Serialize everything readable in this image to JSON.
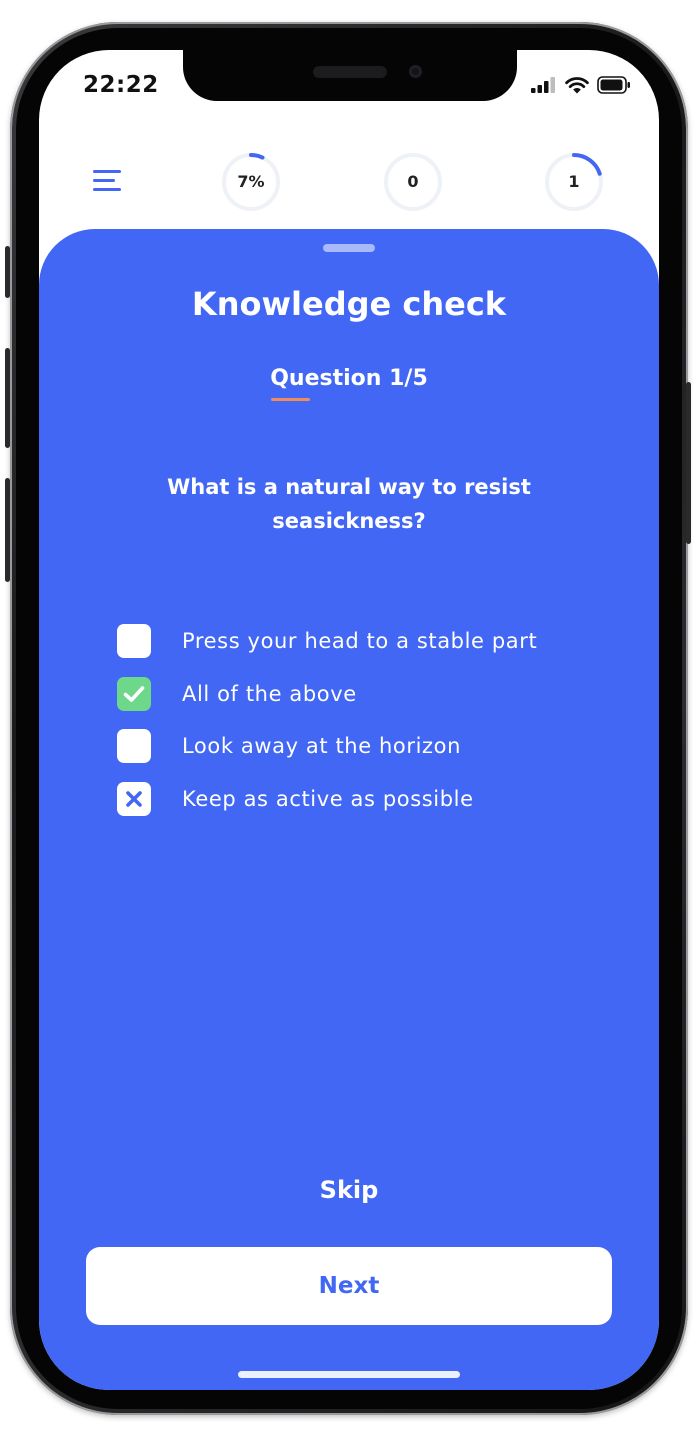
{
  "status_bar": {
    "time": "22:22",
    "icons": [
      "signal-icon",
      "wifi-icon",
      "battery-icon"
    ]
  },
  "header": {
    "menu_icon": "hamburger-menu-icon",
    "progress_ring": {
      "label": "7%",
      "value": 0.07
    },
    "counter_ring_1": {
      "label": "0",
      "value": 0
    },
    "counter_ring_2": {
      "label": "1",
      "value": 0.2
    }
  },
  "quiz": {
    "title": "Knowledge check",
    "question_counter": "Question 1/5",
    "question": "What is a natural way to resist seasickness?",
    "options": [
      {
        "label": "Press your head to a stable part",
        "state": "unchecked"
      },
      {
        "label": "All of the above",
        "state": "checked"
      },
      {
        "label": "Look away at the horizon",
        "state": "unchecked"
      },
      {
        "label": "Keep as active as possible",
        "state": "crossed"
      }
    ],
    "skip_label": "Skip",
    "next_label": "Next"
  },
  "colors": {
    "accent": "#4167f4",
    "checked": "#6ed88a",
    "underline": "#f08c5a"
  }
}
